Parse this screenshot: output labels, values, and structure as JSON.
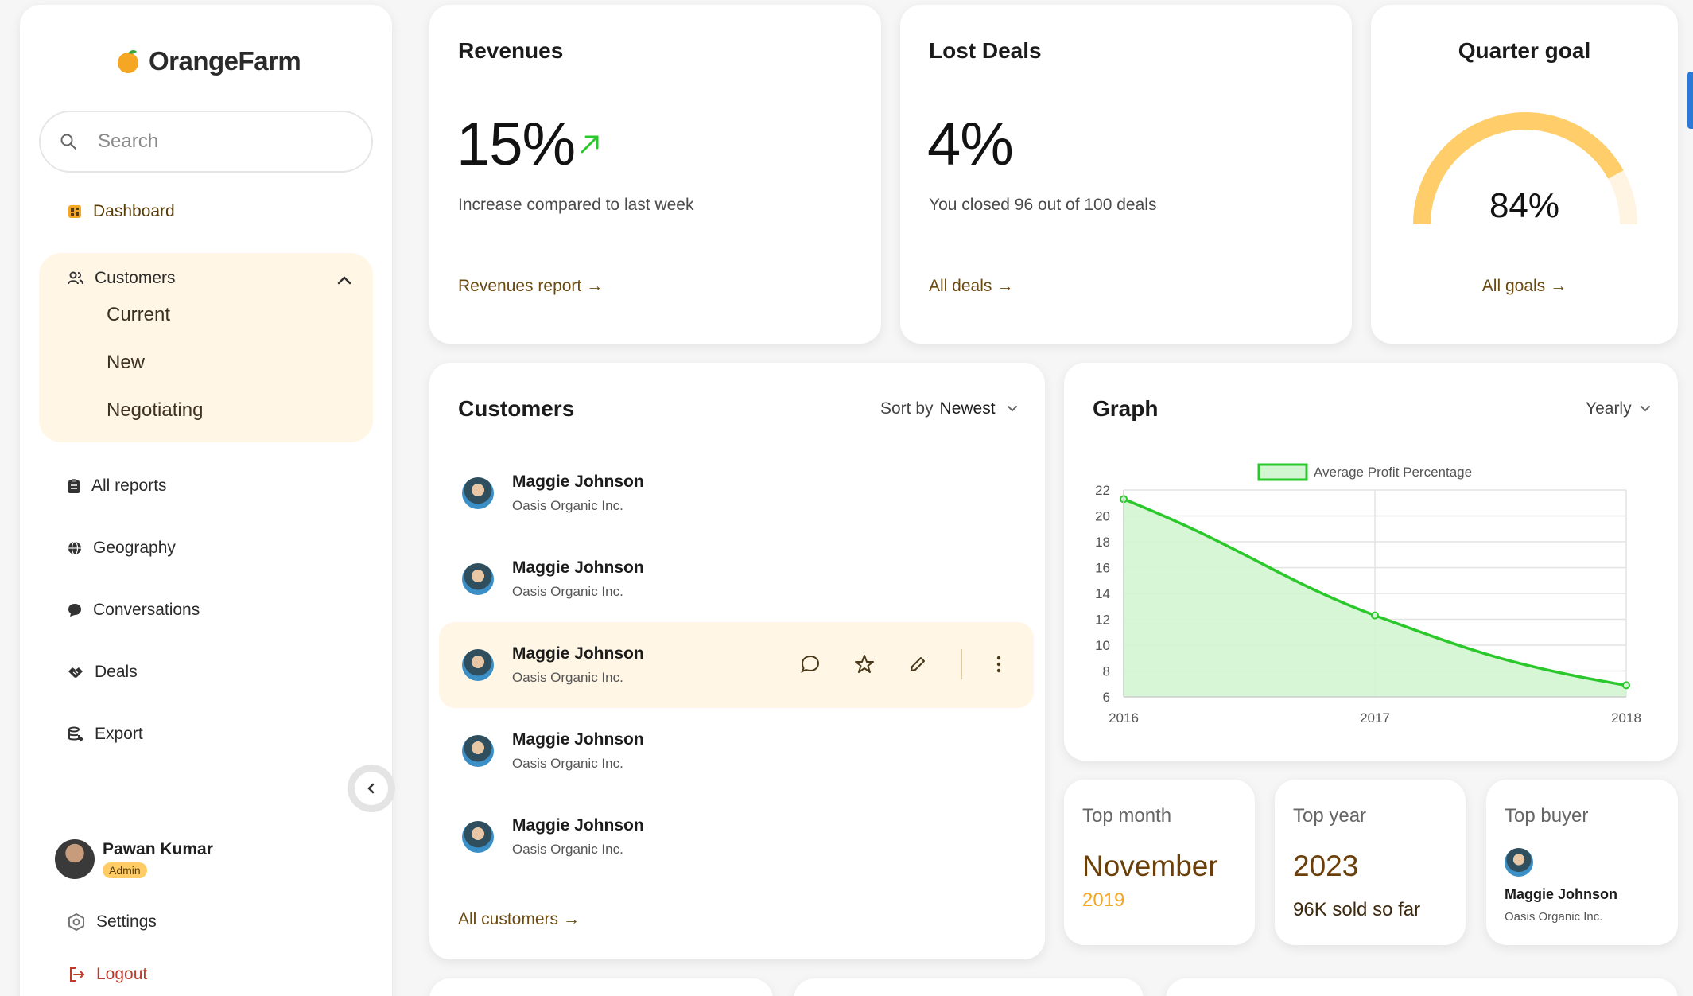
{
  "brand": {
    "name": "OrangeFarm",
    "accent": "#f5a623"
  },
  "search": {
    "placeholder": "Search"
  },
  "nav": {
    "dashboard": "Dashboard",
    "customers": "Customers",
    "customers_sub": [
      "Current",
      "New",
      "Negotiating"
    ],
    "all_reports": "All reports",
    "geography": "Geography",
    "conversations": "Conversations",
    "deals": "Deals",
    "export": "Export"
  },
  "user": {
    "name": "Pawan Kumar",
    "role": "Admin"
  },
  "settings_label": "Settings",
  "logout_label": "Logout",
  "revenues": {
    "title": "Revenues",
    "value": "15%",
    "caption": "Increase compared to last week",
    "link": "Revenues report"
  },
  "lost_deals": {
    "title": "Lost Deals",
    "value": "4%",
    "caption": "You closed 96 out of 100 deals",
    "link": "All deals"
  },
  "quarter_goal": {
    "title": "Quarter goal",
    "value": "84%",
    "progress": 0.84,
    "link": "All goals"
  },
  "customers_card": {
    "title": "Customers",
    "sort_prefix": "Sort by",
    "sort_value": "Newest",
    "rows": [
      {
        "name": "Maggie Johnson",
        "company": "Oasis Organic Inc."
      },
      {
        "name": "Maggie Johnson",
        "company": "Oasis Organic Inc."
      },
      {
        "name": "Maggie Johnson",
        "company": "Oasis Organic Inc."
      },
      {
        "name": "Maggie Johnson",
        "company": "Oasis Organic Inc."
      },
      {
        "name": "Maggie Johnson",
        "company": "Oasis Organic Inc."
      }
    ],
    "link": "All customers"
  },
  "graph_card": {
    "title": "Graph",
    "period": "Yearly"
  },
  "chart_data": {
    "type": "area",
    "x": [
      "2016",
      "2017",
      "2018"
    ],
    "series": [
      {
        "name": "Average Profit Percentage",
        "values": [
          21.3,
          12.3,
          6.9
        ],
        "color": "#2bc82b",
        "fill": "#d2f5d2"
      }
    ],
    "yticks": [
      6,
      8,
      10,
      12,
      14,
      16,
      18,
      20,
      22
    ],
    "ylim": [
      6,
      22
    ],
    "grid": true,
    "legend": "top"
  },
  "stats": {
    "top_month": {
      "label": "Top month",
      "value": "November",
      "sub": "2019"
    },
    "top_year": {
      "label": "Top year",
      "value": "2023",
      "sub": "96K sold so far"
    },
    "top_buyer": {
      "label": "Top buyer",
      "name": "Maggie Johnson",
      "company": "Oasis Organic Inc."
    }
  }
}
